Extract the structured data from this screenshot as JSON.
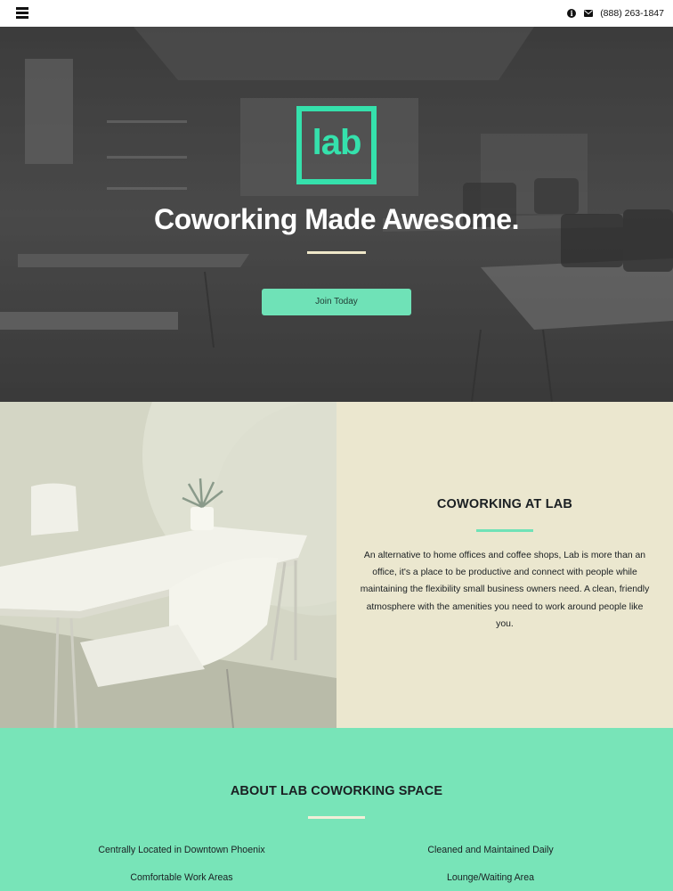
{
  "topbar": {
    "menu_icon": "hamburger-icon",
    "info_icon": "info-icon",
    "mail_icon": "mail-icon",
    "phone": "(888) 263-1847"
  },
  "hero": {
    "logo_text": "lab",
    "title": "Coworking Made Awesome.",
    "cta_label": "Join Today"
  },
  "coworking": {
    "heading": "COWORKING AT LAB",
    "paragraph": "An alternative to home offices and coffee shops, Lab is more than an office, it's a place to be productive and connect with people while maintaining the flexibility small business owners need. A clean, friendly atmosphere with the amenities you need to work around people like you."
  },
  "about": {
    "heading": "ABOUT LAB COWORKING SPACE",
    "features": [
      "Centrally Located in Downtown Phoenix",
      "Cleaned and Maintained Daily",
      "Comfortable Work Areas",
      "Lounge/Waiting Area"
    ]
  },
  "colors": {
    "accent_green": "#35e1ac",
    "button_green": "#6fe2b7",
    "section_green": "#78e4b8",
    "cream": "#ebe7cf"
  }
}
